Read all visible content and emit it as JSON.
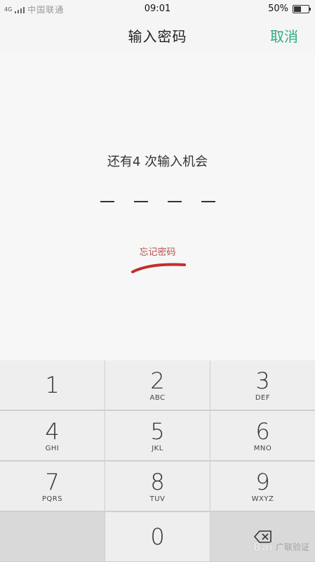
{
  "status_bar": {
    "network": "4G",
    "carrier": "中国联通",
    "time": "09:01",
    "battery": "50%",
    "battery_level": 0.5
  },
  "header": {
    "title": "输入密码",
    "cancel_label": "取消"
  },
  "main": {
    "attempts_text": "还有4 次输入机会",
    "pin_length": 4,
    "forgot_label": "忘记密码"
  },
  "keypad": {
    "keys": [
      {
        "num": "1",
        "letters": ""
      },
      {
        "num": "2",
        "letters": "ABC"
      },
      {
        "num": "3",
        "letters": "DEF"
      },
      {
        "num": "4",
        "letters": "GHI"
      },
      {
        "num": "5",
        "letters": "JKL"
      },
      {
        "num": "6",
        "letters": "MNO"
      },
      {
        "num": "7",
        "letters": "PQRS"
      },
      {
        "num": "8",
        "letters": "TUV"
      },
      {
        "num": "9",
        "letters": "WXYZ"
      },
      {
        "num": "",
        "letters": ""
      },
      {
        "num": "0",
        "letters": ""
      },
      {
        "num": "",
        "letters": ""
      }
    ]
  },
  "watermark": {
    "brand": "Bai",
    "label": "广联验证"
  },
  "colors": {
    "accent": "#2eaa7c",
    "forgot": "#b5524e",
    "scribble": "#c0302b"
  }
}
